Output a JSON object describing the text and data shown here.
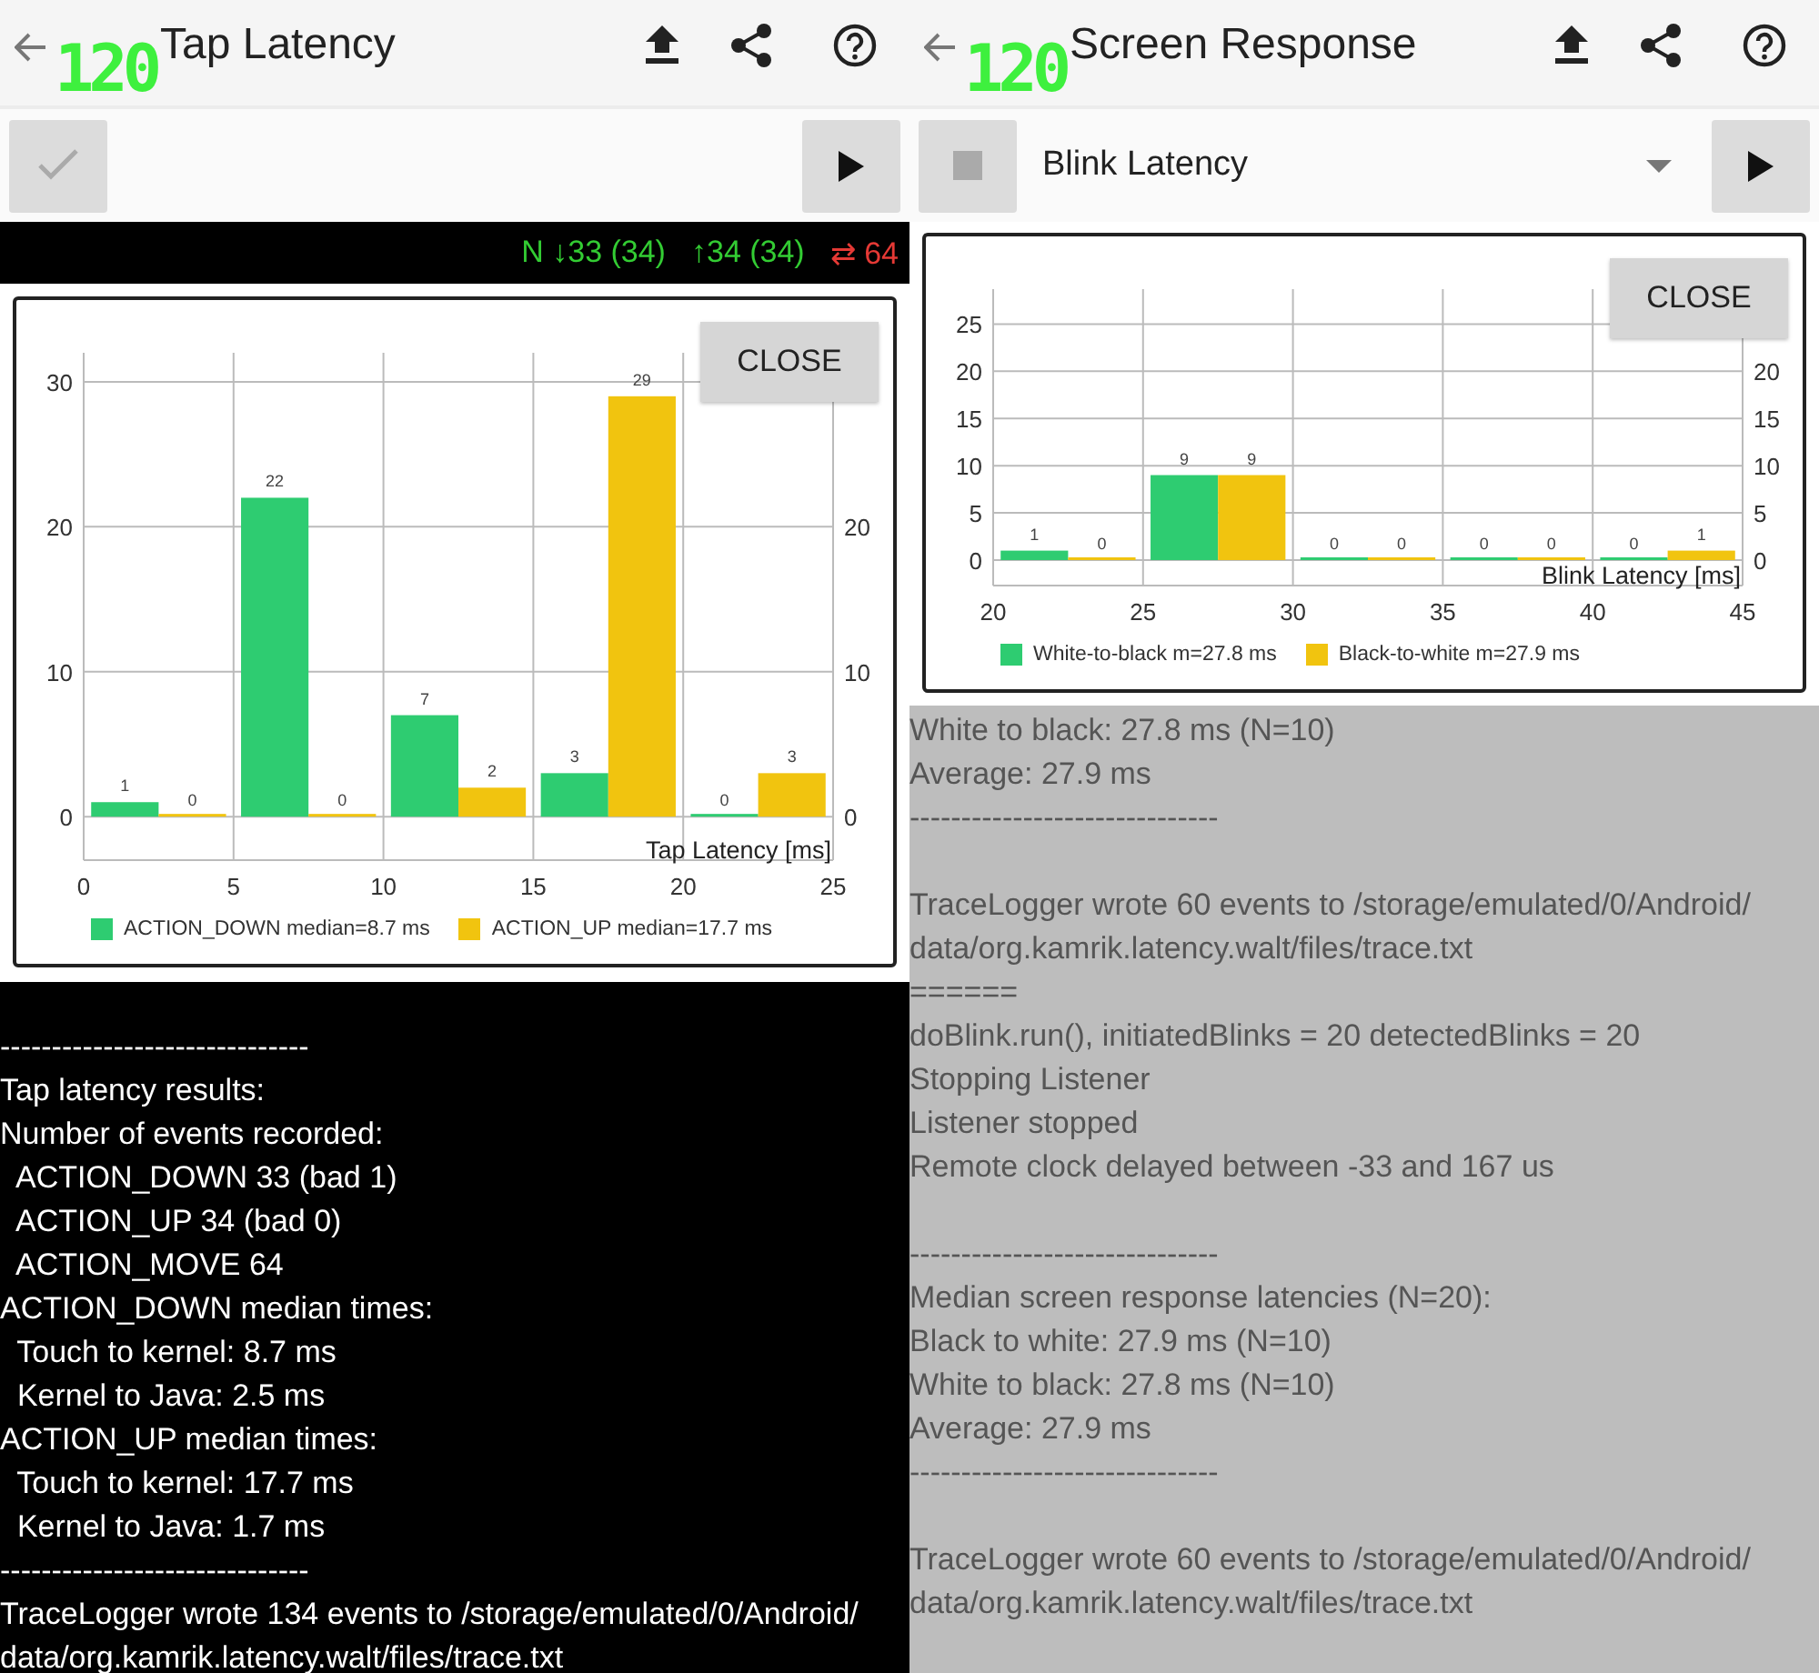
{
  "panes": [
    {
      "kind": "tap",
      "title": "Tap Latency",
      "fps_overlay": "120",
      "status": [
        {
          "text": "N ↓33 (34)",
          "color": "#33cc33"
        },
        {
          "text": "↑34 (34)",
          "color": "#33cc33"
        },
        {
          "text": "⇄ 64",
          "color": "#e53935"
        }
      ],
      "chart": {
        "close_label": "CLOSE",
        "chart_data": {
          "type": "bar",
          "xlabel": "Tap Latency [ms]",
          "x": [
            2.5,
            7.5,
            12.5,
            17.5,
            22.5
          ],
          "series": [
            {
              "name": "ACTION_DOWN median=8.7 ms",
              "color": "#2ecc71",
              "values": [
                1,
                22,
                7,
                3,
                0
              ]
            },
            {
              "name": "ACTION_UP median=17.7 ms",
              "color": "#f1c40f",
              "values": [
                0,
                0,
                2,
                29,
                3
              ]
            }
          ],
          "xlim": [
            0,
            25
          ],
          "ylim": [
            -3,
            32
          ],
          "y2lim": [
            -3,
            32
          ],
          "xticks": [
            0,
            5,
            10,
            15,
            20,
            25
          ],
          "yticks": [
            0,
            10,
            20,
            30
          ],
          "y2ticks": [
            0,
            10,
            20
          ],
          "grid": true,
          "legend": "bottom",
          "data_labels": true
        }
      },
      "log": [
        [
          "------------------------------",
          "Tap latency results:",
          "Number of events recorded:",
          "  ACTION_DOWN 33 (bad 1)",
          "  ACTION_UP 34 (bad 0)",
          "  ACTION_MOVE 64",
          "ACTION_DOWN median times:",
          "  Touch to kernel: 8.7 ms",
          "  Kernel to Java: 2.5 ms",
          "ACTION_UP median times:",
          "  Touch to kernel: 17.7 ms",
          "  Kernel to Java: 1.7 ms",
          "------------------------------",
          "TraceLogger wrote 134 events to /storage/emulated/0/Android/",
          "data/org.kamrik.latency.walt/files/trace.txt"
        ]
      ]
    },
    {
      "kind": "screen",
      "title": "Screen Response",
      "fps_overlay": "120",
      "dropdown": {
        "value": "Blink Latency"
      },
      "chart": {
        "close_label": "CLOSE",
        "chart_data": {
          "type": "bar",
          "xlabel": "Blink Latency [ms]",
          "x": [
            22.5,
            27.5,
            32.5,
            37.5,
            42.5
          ],
          "series": [
            {
              "name": "White-to-black m=27.8 ms",
              "color": "#2ecc71",
              "values": [
                1,
                9,
                0,
                0,
                0
              ]
            },
            {
              "name": "Black-to-white m=27.9 ms",
              "color": "#f1c40f",
              "values": [
                0,
                9,
                0,
                0,
                1
              ]
            }
          ],
          "xlim": [
            20,
            45
          ],
          "ylim": [
            -2.7,
            28.7
          ],
          "y2lim": [
            -2.7,
            28.7
          ],
          "xticks": [
            20,
            25,
            30,
            35,
            40,
            45
          ],
          "yticks": [
            0,
            5,
            10,
            15,
            20,
            25
          ],
          "y2ticks": [
            0,
            5,
            10,
            15,
            20
          ],
          "grid": true,
          "legend": "bottom",
          "data_labels": true
        }
      },
      "log": [
        [
          "White to black: 27.8 ms (N=10)",
          "Average: 27.9 ms",
          "------------------------------"
        ],
        [
          "TraceLogger wrote 60 events to /storage/emulated/0/Android/",
          "data/org.kamrik.latency.walt/files/trace.txt",
          "======",
          "doBlink.run(), initiatedBlinks = 20 detectedBlinks = 20",
          "Stopping Listener",
          "Listener stopped",
          "Remote clock delayed between -33 and 167 us"
        ],
        [
          "------------------------------",
          "Median screen response latencies (N=20):",
          "Black to white: 27.9 ms (N=10)",
          "White to black: 27.8 ms (N=10)",
          "Average: 27.9 ms",
          "------------------------------"
        ],
        [
          "TraceLogger wrote 60 events to /storage/emulated/0/Android/",
          "data/org.kamrik.latency.walt/files/trace.txt"
        ]
      ]
    }
  ]
}
